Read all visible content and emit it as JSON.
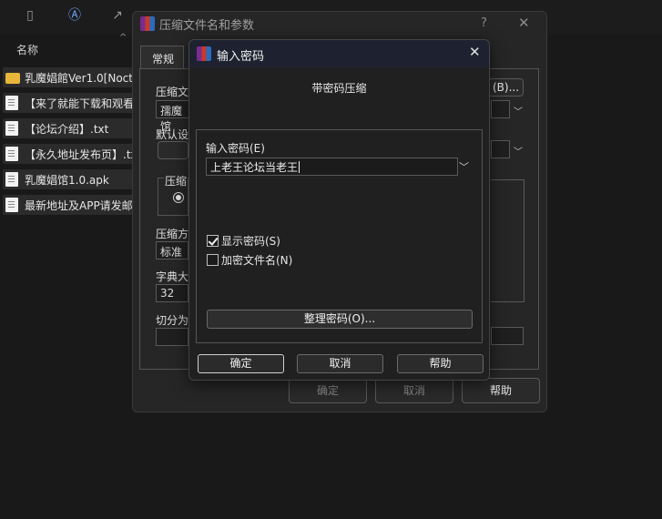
{
  "explorer": {
    "column_name": "名称",
    "files": [
      {
        "name": "乳魔娼館Ver1.0[Noctu",
        "type": "folder"
      },
      {
        "name": "【来了就能下载和观看",
        "type": "doc"
      },
      {
        "name": "【论坛介绍】.txt",
        "type": "doc"
      },
      {
        "name": "【永久地址发布页】.tx",
        "type": "doc"
      },
      {
        "name": "乳魔娼馆1.0.apk",
        "type": "doc"
      },
      {
        "name": "最新地址及APP请发邮",
        "type": "doc"
      }
    ]
  },
  "back_dialog": {
    "title": "压缩文件名和参数",
    "help_glyph": "?",
    "tab_general": "常规",
    "label_archive_name": "压缩文",
    "archive_name_value": "孺魔馆",
    "browse_button": "(B)...",
    "label_default_settings": "默认设",
    "label_archive_format": "压缩",
    "label_method": "压缩方",
    "method_value": "标准",
    "label_dictionary": "字典大",
    "dictionary_value": "32",
    "label_split": "切分为",
    "ok_label": "确定",
    "cancel_label": "取消",
    "help_label": "帮助"
  },
  "password_dialog": {
    "title": "输入密码",
    "subtitle": "带密码压缩",
    "password_label": "输入密码(E)",
    "password_value": "上老王论坛当老王",
    "show_password_label": "显示密码(S)",
    "show_password_checked": true,
    "encrypt_names_label": "加密文件名(N)",
    "encrypt_names_checked": false,
    "organize_button": "整理密码(O)...",
    "ok_label": "确定",
    "cancel_label": "取消",
    "help_label": "帮助"
  },
  "colors": {
    "accent_titlebar": "#1e2230",
    "folder": "#e8b73a"
  }
}
